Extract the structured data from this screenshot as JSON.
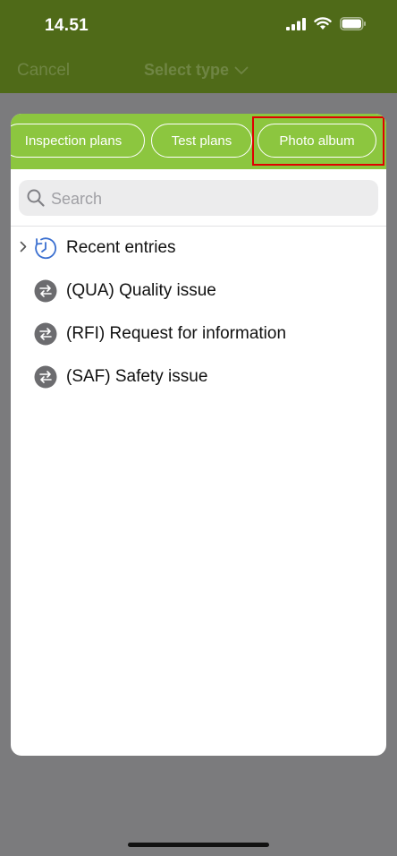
{
  "status_bar": {
    "time": "14.51"
  },
  "nav": {
    "cancel_label": "Cancel",
    "title": "Select type"
  },
  "tabs": [
    {
      "label": "Inspection plans"
    },
    {
      "label": "Test plans"
    },
    {
      "label": "Photo album"
    }
  ],
  "search": {
    "placeholder": "Search",
    "value": ""
  },
  "list": {
    "recent_label": "Recent entries",
    "items": [
      {
        "label": "(QUA) Quality issue",
        "icon": "transfer-icon"
      },
      {
        "label": "(RFI) Request for information",
        "icon": "transfer-icon"
      },
      {
        "label": "(SAF) Safety issue",
        "icon": "transfer-icon"
      }
    ]
  },
  "colors": {
    "header_bg": "#4f6a18",
    "tab_bar_bg": "#8cc63f",
    "highlight": "#e00000",
    "recent_icon": "#3a6fd0",
    "item_icon_bg": "#6c6c6f"
  }
}
